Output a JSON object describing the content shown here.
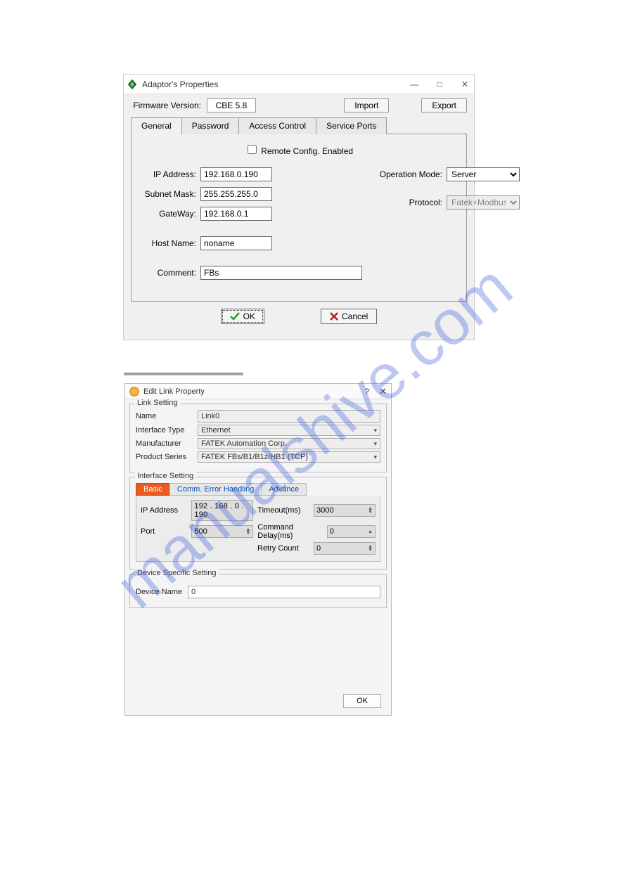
{
  "watermark": "manualshive.com",
  "dlg1": {
    "title": "Adaptor's Properties",
    "firmware_label": "Firmware Version:",
    "firmware_value": "CBE 5.8",
    "import_label": "Import",
    "export_label": "Export",
    "tabs": {
      "general": "General",
      "password": "Password",
      "access": "Access Control",
      "ports": "Service Ports"
    },
    "remote_cfg_label": "Remote Config. Enabled",
    "ip_label": "IP Address:",
    "ip_value": "192.168.0.190",
    "subnet_label": "Subnet Mask:",
    "subnet_value": "255.255.255.0",
    "gateway_label": "GateWay:",
    "gateway_value": "192.168.0.1",
    "host_label": "Host Name:",
    "host_value": "noname",
    "comment_label": "Comment:",
    "comment_value": "FBs",
    "opmode_label": "Operation Mode:",
    "opmode_value": "Server",
    "proto_label": "Protocol:",
    "proto_value": "Fatek+Modbus",
    "ok_label": "OK",
    "cancel_label": "Cancel"
  },
  "dlg2": {
    "title": "Edit Link Property",
    "link_setting_title": "Link Setting",
    "name_label": "Name",
    "name_value": "Link0",
    "iftype_label": "Interface Type",
    "iftype_value": "Ethernet",
    "mfr_label": "Manufacturer",
    "mfr_value": "FATEK Automation Corp.",
    "series_label": "Product Series",
    "series_value": "FATEK FBs/B1/B1z/HB1 (TCP)",
    "ifs_title": "Interface Setting",
    "tabs": {
      "basic": "Basic",
      "comm": "Comm. Error Handling",
      "adv": "Advance"
    },
    "ip_label": "IP Address",
    "ip_value": "192 . 168 .  0  . 190",
    "port_label": "Port",
    "port_value": "500",
    "timeout_label": "Timeout(ms)",
    "timeout_value": "3000",
    "cmddelay_label": "Command Delay(ms)",
    "cmddelay_value": "0",
    "retry_label": "Retry Count",
    "retry_value": "0",
    "dev_title": "Device Specific Setting",
    "devname_label": "Device Name",
    "devname_value": "0",
    "ok_label": "OK"
  }
}
